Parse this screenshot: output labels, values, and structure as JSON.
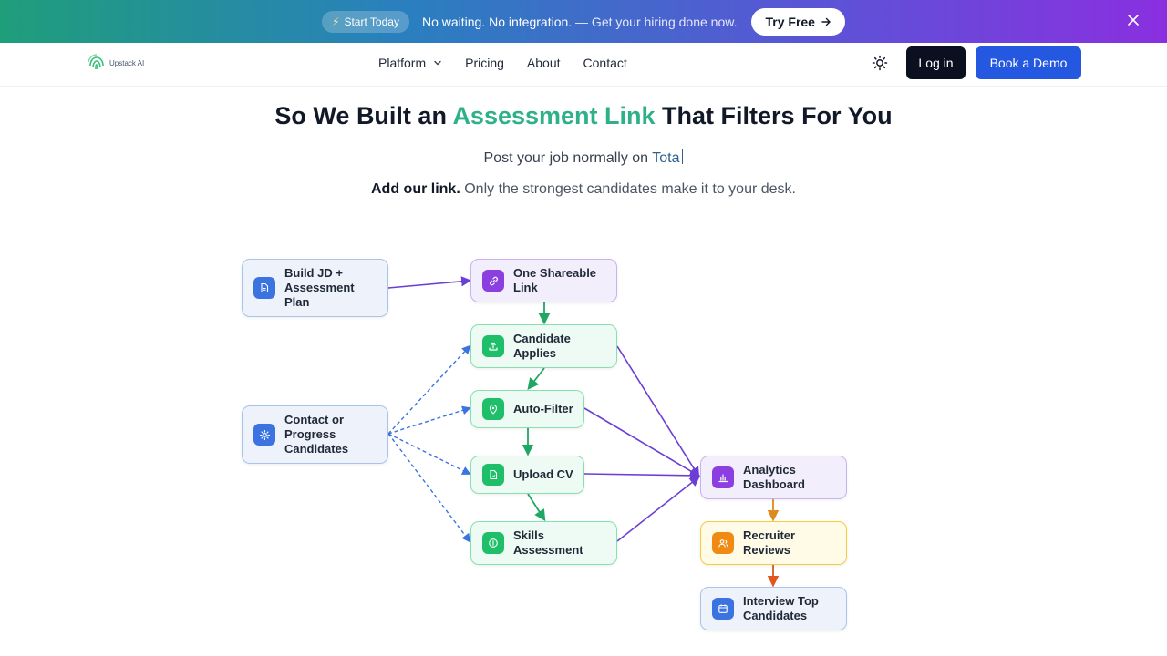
{
  "banner": {
    "pill_label": "Start Today",
    "message_bold": "No waiting. No integration.",
    "message_rest": "— Get your hiring done now.",
    "cta_label": "Try Free",
    "close_icon": "close-icon"
  },
  "nav": {
    "logo_text": "Upstack AI",
    "links": [
      "Platform",
      "Pricing",
      "About",
      "Contact"
    ],
    "login_label": "Log in",
    "demo_label": "Book a Demo",
    "theme_icon": "sun-icon"
  },
  "hero": {
    "headline_pre": "So We Built an",
    "headline_accent": "Assessment Link",
    "headline_post": "That Filters For You",
    "subline_pre": "Post your job normally on",
    "subline_typed": "Tota",
    "tagline_bold": "Add our link.",
    "tagline_rest": "Only the strongest candidates make it to your desk."
  },
  "diagram": {
    "nodes": {
      "build_jd": "Build JD + Assessment Plan",
      "shareable_link": "One Shareable Link",
      "candidate_applies": "Candidate Applies",
      "auto_filter": "Auto-Filter",
      "upload_cv": "Upload CV",
      "skills_assessment": "Skills Assessment",
      "contact_progress": "Contact or Progress Candidates",
      "analytics": "Analytics Dashboard",
      "recruiter_reviews": "Recruiter Reviews",
      "interview": "Interview Top Candidates"
    },
    "colors": {
      "purple_edge": "#6b3fd6",
      "green_edge": "#1fa864",
      "blue_dashed_edge": "#3b74e0",
      "orange_edge": "#e08a1c",
      "red_orange_edge": "#e0561c",
      "accent": "#2eb088",
      "primary_button": "#2458e0"
    }
  }
}
